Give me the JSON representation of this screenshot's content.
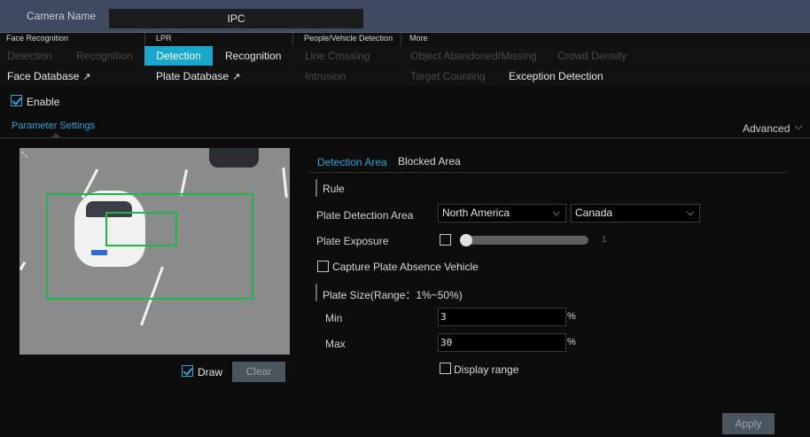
{
  "header": {
    "camera_name_label": "Camera Name",
    "camera_name_value": "IPC"
  },
  "categories": [
    "Face Recognition",
    "LPR",
    "People/Vehicle Detection",
    "More"
  ],
  "tabs_row1": [
    {
      "label": "Detection",
      "state": "dim"
    },
    {
      "label": "Recognition",
      "state": "dim"
    },
    {
      "label": "Detection",
      "state": "active"
    },
    {
      "label": "Recognition",
      "state": "on"
    },
    {
      "label": "Line Crossing",
      "state": "dim"
    },
    {
      "label": "Object Abandoned/Missing",
      "state": "dim"
    },
    {
      "label": "Crowd Density",
      "state": "dim"
    }
  ],
  "tabs_row2": [
    {
      "label": "Face Database",
      "state": "on"
    },
    {
      "label": "Plate Database",
      "state": "on"
    },
    {
      "label": "Intrusion",
      "state": "dim"
    },
    {
      "label": "Target Counting",
      "state": "dim"
    },
    {
      "label": "Exception Detection",
      "state": "on"
    }
  ],
  "enable": {
    "label": "Enable",
    "checked": true
  },
  "param_tab": "Parameter Settings",
  "advanced": "Advanced",
  "draw": {
    "label": "Draw",
    "checked": true
  },
  "clear_button": "Clear",
  "sub_tabs": {
    "detection_area": "Detection Area",
    "blocked_area": "Blocked Area"
  },
  "rule_section": "Rule",
  "plate_detection_area": {
    "label": "Plate Detection Area",
    "region": "North America",
    "country": "Canada"
  },
  "plate_exposure": {
    "label": "Plate Exposure",
    "checked": false,
    "value": "1"
  },
  "capture_absence": {
    "label": "Capture Plate Absence Vehicle",
    "checked": false
  },
  "plate_size": {
    "label": "Plate Size(Range：1%~50%)",
    "min_label": "Min",
    "min_value": "3",
    "max_label": "Max",
    "max_value": "30",
    "unit": "%"
  },
  "display_range": {
    "label": "Display range",
    "checked": false
  },
  "apply_button": "Apply",
  "colors": {
    "accent": "#1aa7cc",
    "box": "#20b64a",
    "topbar": "#3f4a60"
  }
}
